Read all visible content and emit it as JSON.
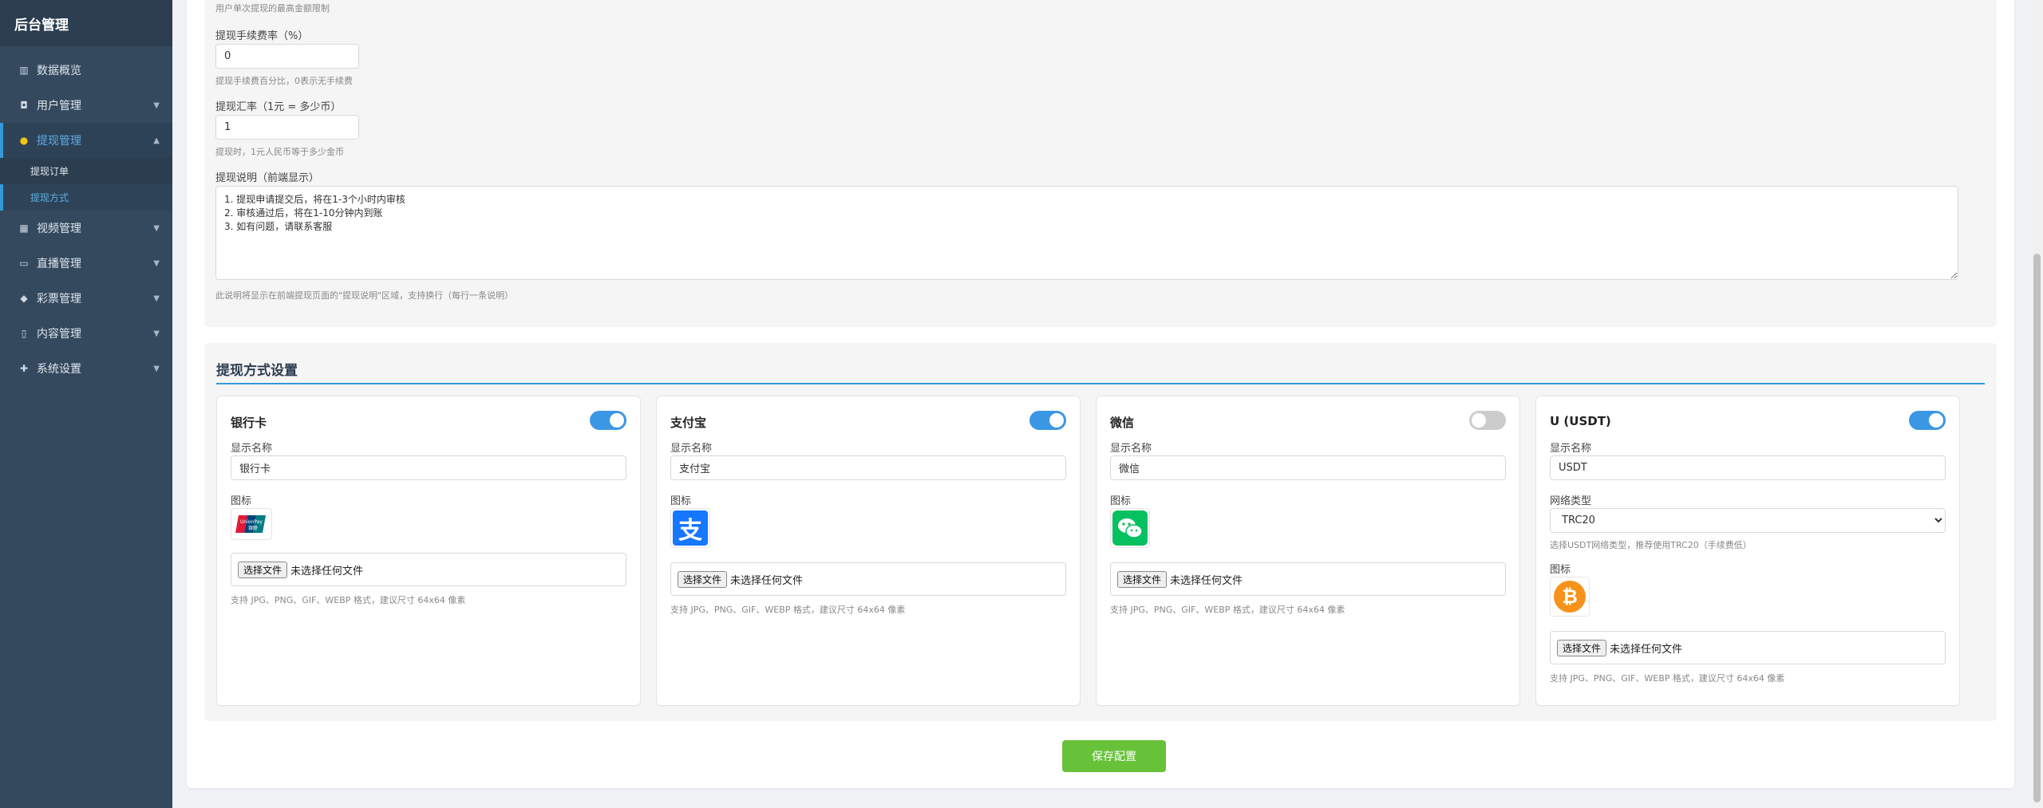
{
  "sidebar": {
    "brand": "后台管理",
    "items": [
      {
        "label": "数据概览",
        "icon": "chart-icon",
        "glyph": "▥"
      },
      {
        "label": "用户管理",
        "icon": "user-icon",
        "glyph": "◘"
      },
      {
        "label": "提现管理",
        "icon": "money-bag-icon",
        "glyph": "●"
      },
      {
        "label": "视频管理",
        "icon": "film-icon",
        "glyph": "▦"
      },
      {
        "label": "直播管理",
        "icon": "tv-icon",
        "glyph": "▭"
      },
      {
        "label": "彩票管理",
        "icon": "cube-icon",
        "glyph": "◆"
      },
      {
        "label": "内容管理",
        "icon": "document-icon",
        "glyph": "▯"
      },
      {
        "label": "系统设置",
        "icon": "gear-icon",
        "glyph": "✚"
      }
    ],
    "submenu": [
      "提现订单",
      "提现方式"
    ]
  },
  "basic": {
    "max_hint": "用户单次提现的最高金额限制",
    "fee_label": "提现手续费率（%）",
    "fee_value": "0",
    "fee_hint": "提现手续费百分比，0表示无手续费",
    "rate_label": "提现汇率（1元 = 多少币）",
    "rate_value": "1",
    "rate_hint": "提现时，1元人民币等于多少金币",
    "desc_label": "提现说明（前端显示）",
    "desc_value": "1. 提现申请提交后，将在1-3个小时内审核\n2. 审核通过后，将在1-10分钟内到账\n3. 如有问题，请联系客服",
    "desc_hint": "此说明将显示在前端提现页面的\"提现说明\"区域，支持换行（每行一条说明）"
  },
  "methods": {
    "title": "提现方式设置",
    "display_name_label": "显示名称",
    "icon_label": "图标",
    "network_label": "网络类型",
    "network_hint": "选择USDT网络类型，推荐使用TRC20（手续费低）",
    "file_button": "选择文件",
    "file_none": "未选择任何文件",
    "file_hint": "支持 JPG、PNG、GIF、WEBP 格式，建议尺寸 64x64 像素",
    "cards": [
      {
        "name": "银行卡",
        "enabled": true,
        "display_name": "银行卡",
        "icon": "unionpay-icon",
        "icon_text": "UnionPay\n银联"
      },
      {
        "name": "支付宝",
        "enabled": true,
        "display_name": "支付宝",
        "icon": "alipay-icon",
        "icon_text": "支"
      },
      {
        "name": "微信",
        "enabled": false,
        "display_name": "微信",
        "icon": "wechat-icon"
      },
      {
        "name": "U (USDT)",
        "enabled": true,
        "display_name": "USDT",
        "network": "TRC20",
        "icon": "bitcoin-icon",
        "icon_text": "₿"
      }
    ]
  },
  "save_label": "保存配置",
  "colors": {
    "primary": "#3498db",
    "success": "#67c23a",
    "sidebar": "#34495e",
    "alipay": "#1677ff",
    "wechat": "#07c160",
    "bitcoin": "#f7931a"
  }
}
